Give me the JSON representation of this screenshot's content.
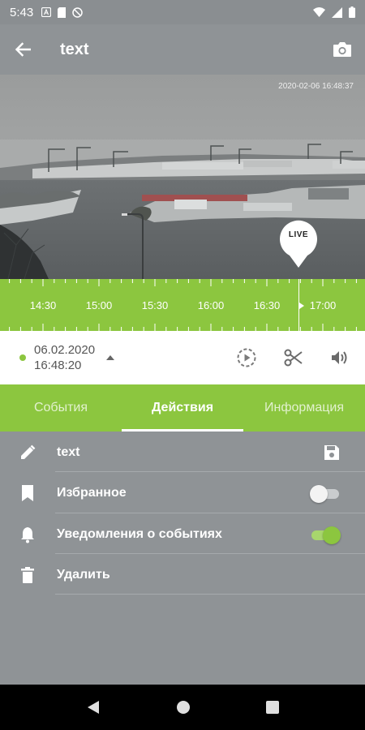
{
  "status_bar": {
    "time": "5:43",
    "icons": [
      "notification-a-icon",
      "sim-icon",
      "no-data-icon"
    ],
    "right_icons": [
      "wifi-icon",
      "signal-icon",
      "battery-icon"
    ]
  },
  "app_bar": {
    "title": "text",
    "back_icon": "arrow-left-icon",
    "camera_icon": "camera-icon"
  },
  "video": {
    "timestamp": "2020-02-06 16:48:37",
    "live_label": "LIVE"
  },
  "timeline": {
    "labels": [
      "14:30",
      "15:00",
      "15:30",
      "16:00",
      "16:30",
      "17:00"
    ]
  },
  "date_bar": {
    "date": "06.02.2020",
    "time": "16:48:20"
  },
  "tabs": [
    {
      "label": "События",
      "active": false
    },
    {
      "label": "Действия",
      "active": true
    },
    {
      "label": "Информация",
      "active": false
    }
  ],
  "actions": [
    {
      "label": "text",
      "icon": "pencil-icon",
      "right": "save-icon"
    },
    {
      "label": "Избранное",
      "icon": "bookmark-icon",
      "toggle": false
    },
    {
      "label": "Уведомления о событиях",
      "icon": "bell-icon",
      "toggle": true
    },
    {
      "label": "Удалить",
      "icon": "trash-icon"
    }
  ],
  "colors": {
    "accent": "#8cc63f",
    "background": "#8f9396"
  }
}
